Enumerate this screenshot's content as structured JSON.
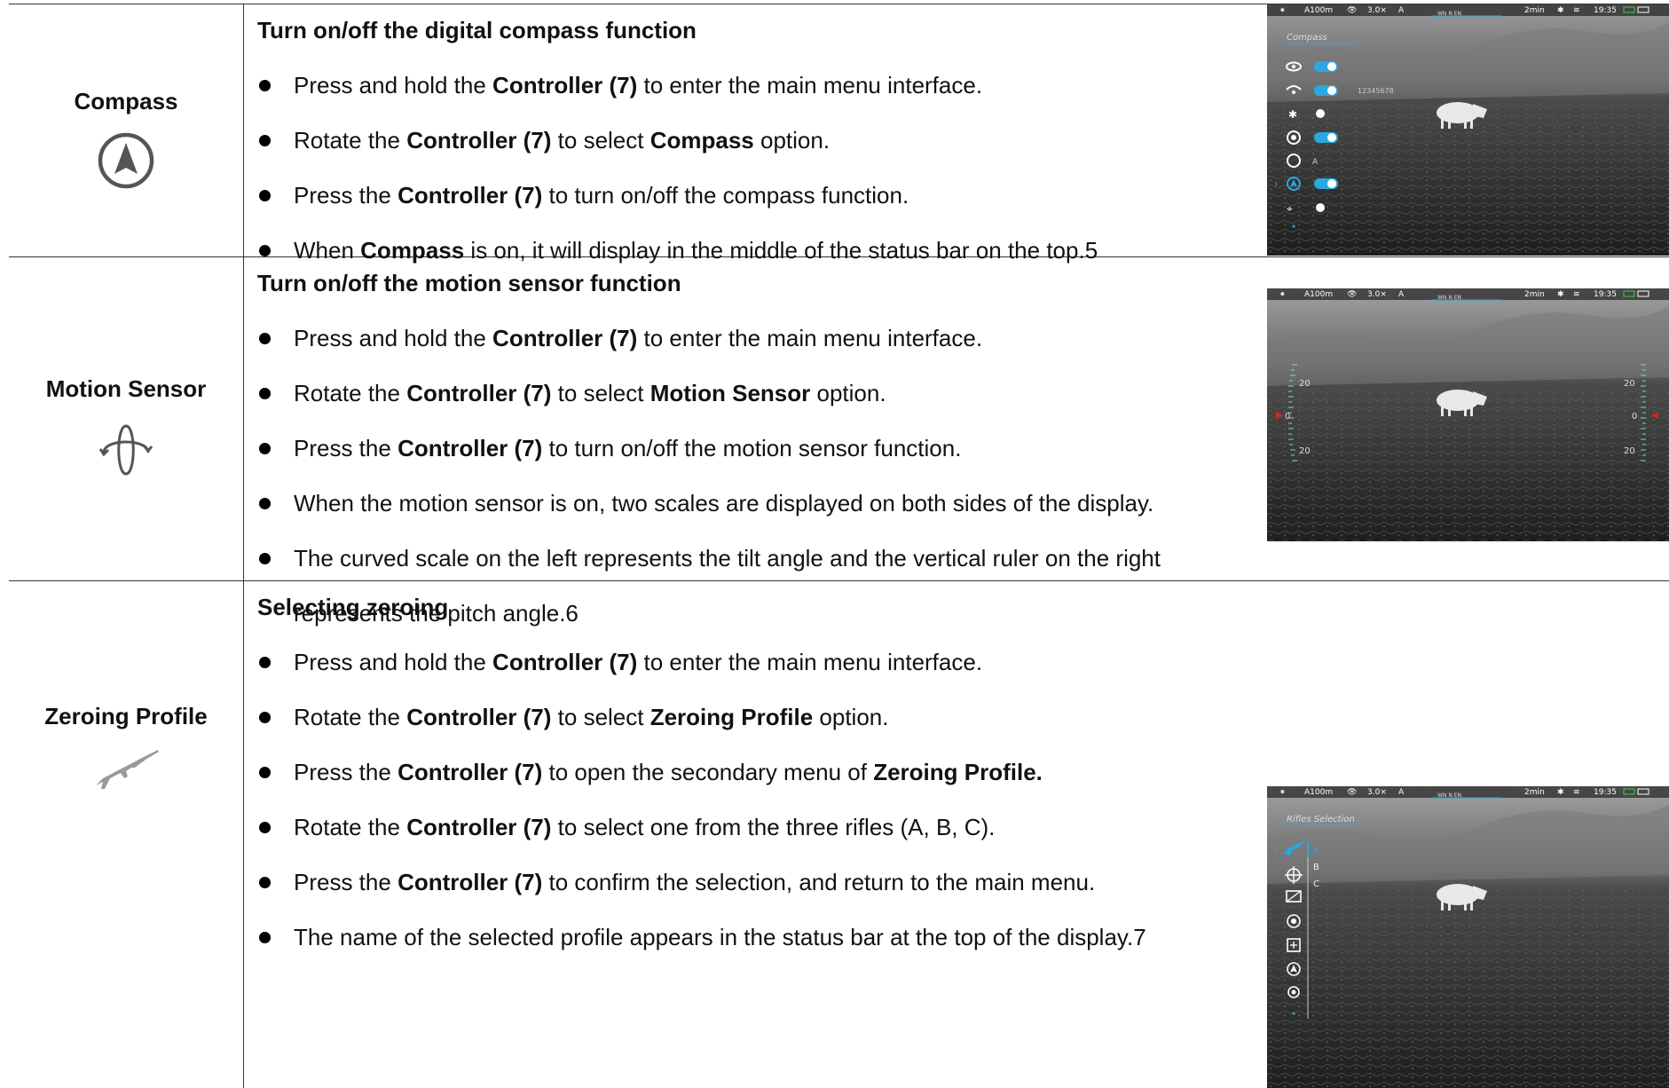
{
  "rows": [
    {
      "name": "Compass",
      "icon": "compass-icon",
      "title": "Turn on/off the digital compass function",
      "bullets": [
        [
          {
            "t": "Press and hold the "
          },
          {
            "t": "Controller (7)",
            "b": true
          },
          {
            "t": " to enter the main menu interface."
          }
        ],
        [
          {
            "t": "Rotate the "
          },
          {
            "t": "Controller (7)",
            "b": true
          },
          {
            "t": " to select "
          },
          {
            "t": "Compass",
            "b": true
          },
          {
            "t": " option."
          }
        ],
        [
          {
            "t": "Press the "
          },
          {
            "t": "Controller (7)",
            "b": true
          },
          {
            "t": " to turn on/off the compass function."
          }
        ],
        [
          {
            "t": "When "
          },
          {
            "t": "Compass",
            "b": true
          },
          {
            "t": " is on, it will display in the middle of the status bar on the top.5"
          }
        ]
      ],
      "screen": {
        "status": {
          "range": "A100m",
          "zoom": "3.0×",
          "mode": "A",
          "compass": "WN  N  EN",
          "timer": "2min",
          "time": "19:35"
        },
        "menu_title": "Compass",
        "hotspot_code": "12345678",
        "mode_label": "A"
      }
    },
    {
      "name": "Motion Sensor",
      "icon": "motion-sensor-icon",
      "title": "Turn on/off the motion sensor function",
      "bullets": [
        [
          {
            "t": "Press and hold the "
          },
          {
            "t": "Controller (7)",
            "b": true
          },
          {
            "t": " to enter the main menu interface."
          }
        ],
        [
          {
            "t": "Rotate the "
          },
          {
            "t": "Controller (7)",
            "b": true
          },
          {
            "t": " to select "
          },
          {
            "t": "Motion Sensor",
            "b": true
          },
          {
            "t": " option."
          }
        ],
        [
          {
            "t": "Press the "
          },
          {
            "t": "Controller (7)",
            "b": true
          },
          {
            "t": " to turn on/off the motion sensor function."
          }
        ],
        [
          {
            "t": "When the motion sensor is on, two scales are displayed on both sides of the display."
          }
        ],
        [
          {
            "t": "The curved scale on the left represents the tilt angle and the vertical ruler on the right represents the pitch angle.6"
          }
        ]
      ],
      "screen": {
        "status": {
          "range": "A100m",
          "zoom": "3.0×",
          "mode": "A",
          "compass": "WN  N  EN",
          "timer": "2min",
          "time": "19:35"
        },
        "scale_labels": [
          "20",
          "0",
          "20"
        ]
      }
    },
    {
      "name": "Zeroing Profile",
      "icon": "rifle-icon",
      "title": "Selecting zeroing",
      "bullets": [
        [
          {
            "t": "Press and hold the "
          },
          {
            "t": "Controller (7)",
            "b": true
          },
          {
            "t": " to enter the main menu interface."
          }
        ],
        [
          {
            "t": "Rotate the "
          },
          {
            "t": "Controller (7)",
            "b": true
          },
          {
            "t": " to select "
          },
          {
            "t": "Zeroing Profile",
            "b": true
          },
          {
            "t": " option."
          }
        ],
        [
          {
            "t": "Press the "
          },
          {
            "t": "Controller (7)",
            "b": true
          },
          {
            "t": " to open the secondary menu of "
          },
          {
            "t": "Zeroing Profile.",
            "b": true
          }
        ],
        [
          {
            "t": "Rotate the "
          },
          {
            "t": "Controller (7)",
            "b": true
          },
          {
            "t": " to select one from the three rifles (A, B, C)."
          }
        ],
        [
          {
            "t": "Press the "
          },
          {
            "t": "Controller (7)",
            "b": true
          },
          {
            "t": " to confirm the selection, and return to the main menu."
          }
        ],
        [
          {
            "t": "The name of the selected profile appears in the status bar at the top of the display.7"
          }
        ]
      ],
      "screen": {
        "status": {
          "range": "A100m",
          "zoom": "3.0×",
          "mode": "A",
          "compass": "WN  N  EN",
          "timer": "2min",
          "time": "19:35"
        },
        "menu_title": "Rifles Selection",
        "rifles": [
          "A",
          "B",
          "C"
        ]
      }
    }
  ],
  "colors": {
    "accent": "#2aa8e0",
    "text": "#111111",
    "rule": "#333333",
    "icon": "#555555"
  }
}
